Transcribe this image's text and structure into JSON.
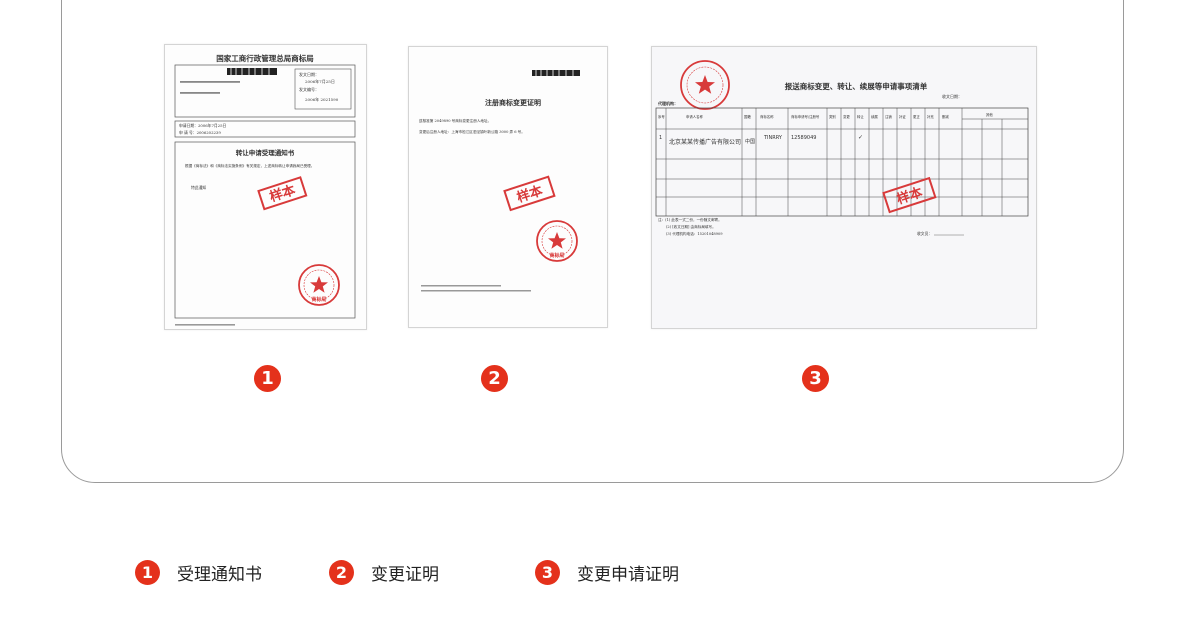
{
  "documents": [
    {
      "header_title": "国家工商行政管理总局商标局",
      "sent_date_label": "发文日期：",
      "sent_date": "2006年7月25日",
      "doc_no_label": "发文编号：",
      "doc_no": "2006年 2021590",
      "apply_date": "申请日期：2006年7月25日",
      "apply_no": "申 请 号：2006202239",
      "title": "转让申请受理通知书",
      "body": "根据《商标法》和《商标法实施条例》有关规定，上述商标转让申请我局已受理。",
      "footer": "特此通知",
      "stamp_text": "样本",
      "seal_text": "商标局"
    },
    {
      "title": "注册商标变更证明",
      "line1": "兹核准第 2049890 号商标变更注册人地址。",
      "line2": "变更后注册人地址：上海市松江区泗泾镇叶新公路 3000 弄 6 号。",
      "stamp_text": "样本",
      "seal_text": "商标局"
    },
    {
      "title": "报送商标变更、转让、续展等申请事项清单",
      "sent_date_label": "收文日期：",
      "agency_label": "代理机构：",
      "columns": [
        "序号",
        "申请人名称",
        "国籍",
        "商标名称",
        "商标申请号/注册号",
        "类别",
        "变更",
        "转让",
        "续展",
        "注销",
        "补证",
        "更正",
        "补充",
        "删减",
        "其他"
      ],
      "rows": [
        {
          "no": "1",
          "applicant": "北京某某传播广告有限公司",
          "nation": "中国",
          "mark": "TINRRY",
          "reg_no": "12589049",
          "check": "✓"
        }
      ],
      "note1": "注：(1) 此表一式二份，一份随文邮寄。",
      "note2": "(2) [收文日期] 由商标局填写。",
      "note3": "(3) 代理机构电话：15201048909",
      "receiver_label": "收文员：",
      "stamp_text": "样本"
    }
  ],
  "badges": [
    "1",
    "2",
    "3"
  ],
  "legend": [
    {
      "number": "1",
      "label": "受理通知书"
    },
    {
      "number": "2",
      "label": "变更证明"
    },
    {
      "number": "3",
      "label": "变更申请证明"
    }
  ],
  "colors": {
    "accent": "#e4311b",
    "border": "#9a9a9a"
  }
}
